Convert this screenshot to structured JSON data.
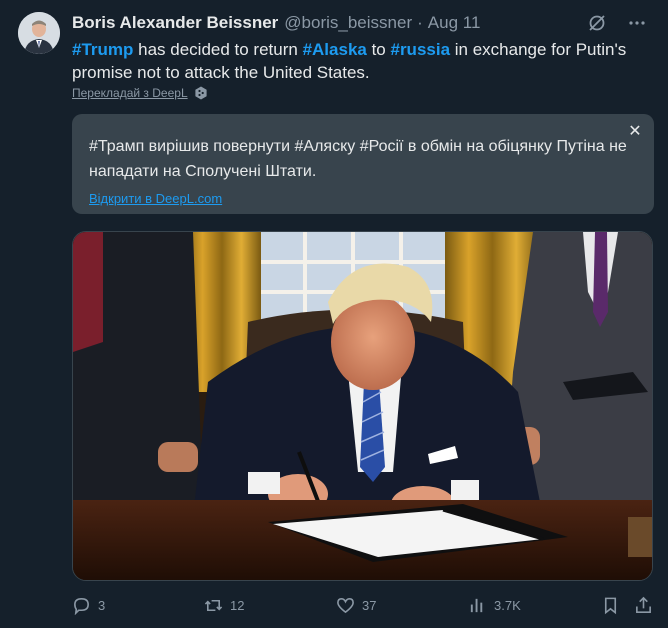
{
  "tweet": {
    "author_name": "Boris Alexander Beissner",
    "author_handle": "@boris_beissner",
    "separator": "·",
    "date": "Aug 11",
    "text_parts": [
      "#Trump",
      " has decided to return ",
      "#Alaska",
      " to ",
      "#russia",
      " in exchange for Putin's promise not to attack the United States."
    ],
    "translate_label": "Перекладай з DeepL",
    "translation_text": "#Трамп вирішив повернути #Аляску #Росії в обмін на обіцянку Путіна не нападати на Сполучені Штати.",
    "translation_close": "✕",
    "deepl_open_label": "Відкрити в DeepL.com"
  },
  "actions": {
    "replies": "3",
    "reposts": "12",
    "likes": "37",
    "views": "3.7K"
  },
  "colors": {
    "background": "#15202b",
    "accent": "#1d9bf0",
    "muted": "#8b98a5",
    "translation_bg": "#38444d"
  },
  "icons": [
    "grok-icon",
    "more-icon",
    "deepl-icon",
    "close-icon",
    "reply-icon",
    "repost-icon",
    "like-icon",
    "views-icon",
    "bookmark-icon",
    "share-icon"
  ]
}
